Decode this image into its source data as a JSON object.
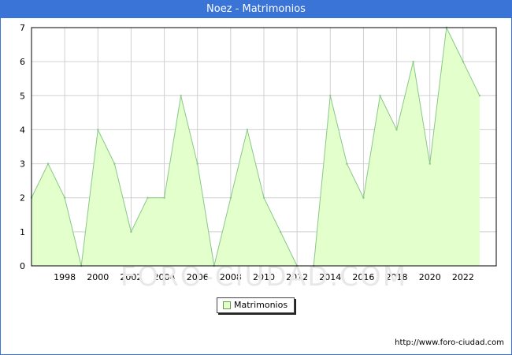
{
  "window": {
    "title": "Noez - Matrimonios"
  },
  "chart_data": {
    "type": "area",
    "title": "Noez - Matrimonios",
    "x": [
      1996,
      1997,
      1998,
      1999,
      2000,
      2001,
      2002,
      2003,
      2004,
      2005,
      2006,
      2007,
      2008,
      2009,
      2010,
      2011,
      2012,
      2013,
      2014,
      2015,
      2016,
      2017,
      2018,
      2019,
      2020,
      2021,
      2022,
      2023
    ],
    "series": [
      {
        "name": "Matrimonios",
        "values": [
          2,
          3,
          2,
          0,
          4,
          3,
          1,
          2,
          2,
          5,
          3,
          0,
          2,
          4,
          2,
          1,
          0,
          0,
          5,
          3,
          2,
          5,
          4,
          6,
          3,
          7,
          6,
          5
        ]
      }
    ],
    "x_ticks": [
      "1998",
      "2000",
      "2002",
      "2004",
      "2006",
      "2008",
      "2010",
      "2012",
      "2014",
      "2016",
      "2018",
      "2020",
      "2022"
    ],
    "y_ticks": [
      "0",
      "1",
      "2",
      "3",
      "4",
      "5",
      "6",
      "7"
    ],
    "xlim": [
      1996,
      2024
    ],
    "ylim": [
      0,
      7
    ],
    "grid": true,
    "legend_position": "bottom-center",
    "colors": {
      "fill": "#e3ffcc",
      "line": "#88c888",
      "grid": "#d0d0d0",
      "header": "#3a74d6"
    }
  },
  "legend": {
    "label": "Matrimonios"
  },
  "watermark": "FORO-CIUDAD.COM",
  "source": "http://www.foro-ciudad.com"
}
